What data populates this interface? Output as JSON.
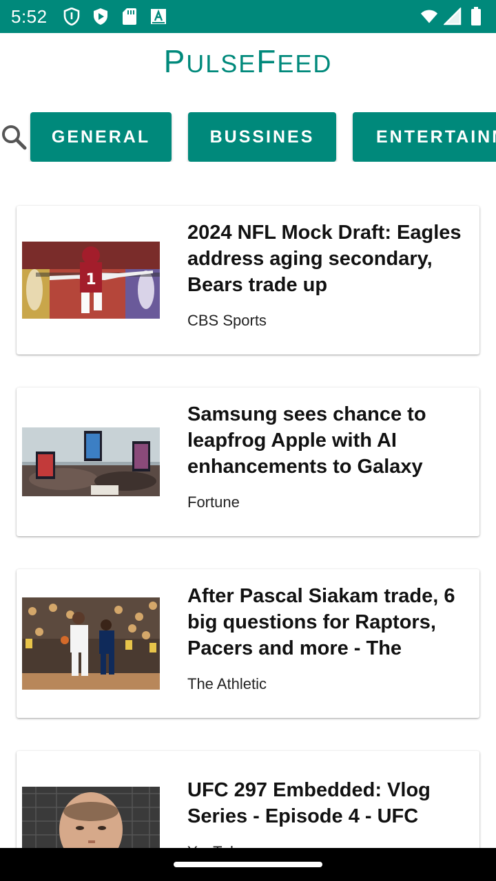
{
  "status_bar": {
    "time": "5:52",
    "left_icons": [
      "shield-icon",
      "play-protect-icon",
      "sd-card-icon",
      "font-a-icon"
    ],
    "right_icons": [
      "wifi-icon",
      "signal-icon",
      "battery-icon"
    ],
    "color": "#00897b"
  },
  "app": {
    "title_first": "P",
    "title_first_rest": "ULSE",
    "title_second": "F",
    "title_second_rest": "EED",
    "accent_color": "#00897b"
  },
  "categories": {
    "search_icon": "search-icon",
    "items": [
      {
        "label": "GENERAL"
      },
      {
        "label": "BUSSINES"
      },
      {
        "label": "ENTERTAINMENT"
      }
    ]
  },
  "articles": [
    {
      "title": "2024 NFL Mock Draft: Eagles address aging secondary, Bears trade up",
      "source": "CBS Sports",
      "image": "football-player-photo"
    },
    {
      "title": "Samsung sees chance to leapfrog Apple with AI enhancements to Galaxy",
      "source": "Fortune",
      "image": "samsung-phones-display-photo"
    },
    {
      "title": "After Pascal Siakam trade, 6 big questions for Raptors, Pacers and more - The",
      "source": "The Athletic",
      "image": "basketball-game-photo"
    },
    {
      "title": "UFC 297 Embedded: Vlog Series - Episode 4 - UFC",
      "source": "YouTube",
      "image": "ufc-fighter-photo"
    }
  ]
}
